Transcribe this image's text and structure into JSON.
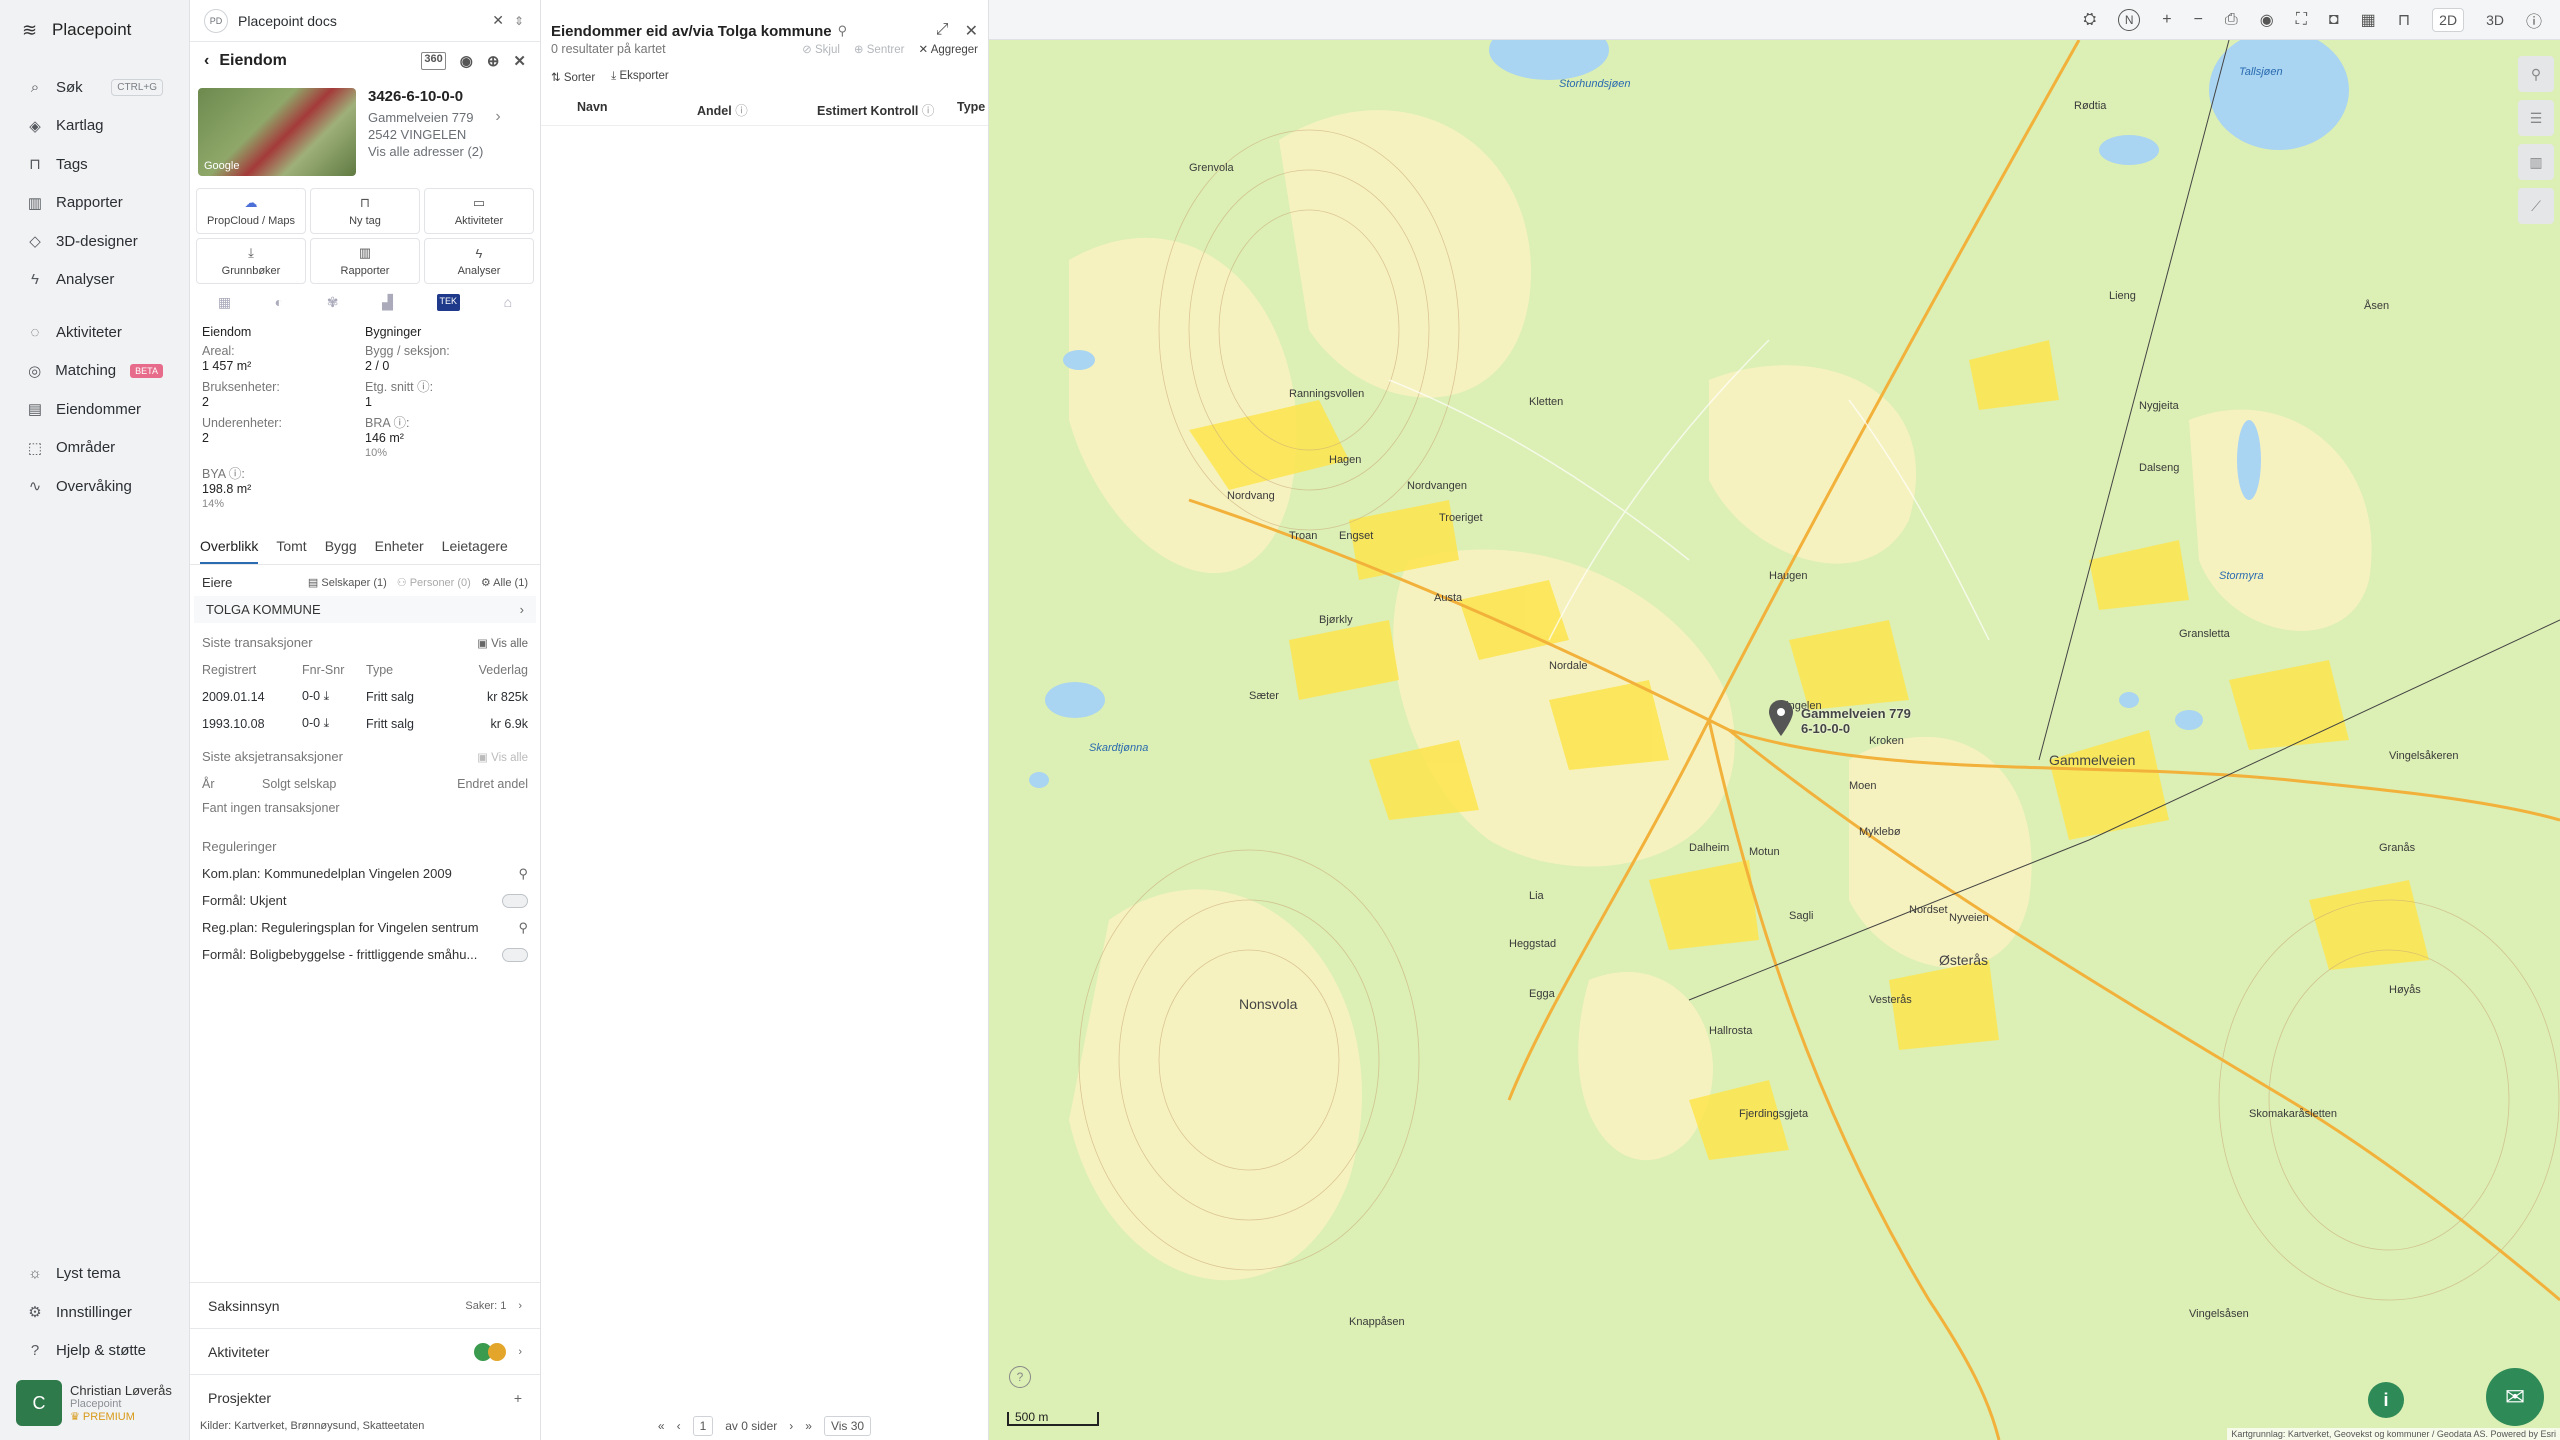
{
  "sidebar": {
    "brand": "Placepoint",
    "items": [
      {
        "label": "Søk",
        "kbd": "CTRL+G"
      },
      {
        "label": "Kartlag"
      },
      {
        "label": "Tags"
      },
      {
        "label": "Rapporter"
      },
      {
        "label": "3D-designer"
      },
      {
        "label": "Analyser"
      },
      {
        "label": "Aktiviteter"
      },
      {
        "label": "Matching",
        "badge": "BETA"
      },
      {
        "label": "Eiendommer"
      },
      {
        "label": "Områder"
      },
      {
        "label": "Overvåking"
      }
    ],
    "bottom": [
      {
        "label": "Lyst tema"
      },
      {
        "label": "Innstillinger"
      },
      {
        "label": "Hjelp & støtte"
      }
    ],
    "user": {
      "initial": "C",
      "name": "Christian Løverås",
      "org": "Placepoint",
      "plan": "PREMIUM"
    }
  },
  "panel": {
    "workspace": "Placepoint docs",
    "workspace_initials": "PD",
    "title": "Eiendom",
    "property": {
      "id": "3426-6-10-0-0",
      "address": "Gammelveien 779",
      "postal": "2542 VINGELEN",
      "all_addresses": "Vis alle adresser (2)",
      "photo_credit": "Google"
    },
    "quick": [
      {
        "label": "PropCloud / Maps"
      },
      {
        "label": "Ny tag"
      },
      {
        "label": "Aktiviteter"
      },
      {
        "label": "Grunnbøker"
      },
      {
        "label": "Rapporter"
      },
      {
        "label": "Analyser"
      }
    ],
    "tek_badge": "TEK",
    "facts": {
      "eiendom_h": "Eiendom",
      "bygninger_h": "Bygninger",
      "areal_k": "Areal:",
      "areal_v": "1 457 m²",
      "bygg_k": "Bygg / seksjon:",
      "bygg_v": "2 / 0",
      "bruks_k": "Bruksenheter:",
      "bruks_v": "2",
      "etg_k": "Etg. snitt ⓘ:",
      "etg_v": "1",
      "under_k": "Underenheter:",
      "under_v": "2",
      "bra_k": "BRA ⓘ:",
      "bra_v": "146 m²",
      "bra_pct": "10%",
      "bya_k": "BYA ⓘ:",
      "bya_v": "198.8 m²",
      "bya_pct": "14%"
    },
    "tabs": [
      "Overblikk",
      "Tomt",
      "Bygg",
      "Enheter",
      "Leietagere"
    ],
    "owners": {
      "label": "Eiere",
      "companies": "Selskaper (1)",
      "persons": "Personer (0)",
      "all": "Alle (1)",
      "owner": "TOLGA KOMMUNE"
    },
    "transactions": {
      "label": "Siste transaksjoner",
      "show_all": "Vis alle",
      "headers": [
        "Registrert",
        "Fnr-Snr",
        "Type",
        "Vederlag"
      ],
      "rows": [
        {
          "date": "2009.01.14",
          "fnr": "0-0",
          "type": "Fritt salg",
          "amount": "kr 825k"
        },
        {
          "date": "1993.10.08",
          "fnr": "0-0",
          "type": "Fritt salg",
          "amount": "kr 6.9k"
        }
      ]
    },
    "share_tx": {
      "label": "Siste aksjetransaksjoner",
      "show_all": "Vis alle",
      "headers": [
        "År",
        "Solgt selskap",
        "Endret andel"
      ],
      "empty": "Fant ingen transaksjoner"
    },
    "regulations": {
      "label": "Reguleringer",
      "rows": [
        {
          "text": "Kom.plan: Kommunedelplan Vingelen 2009"
        },
        {
          "text": "Formål: Ukjent"
        },
        {
          "text": "Reg.plan: Reguleringsplan for Vingelen sentrum"
        },
        {
          "text": "Formål: Boligbebyggelse - frittliggende småhu..."
        }
      ]
    },
    "saksinnsyn": {
      "label": "Saksinnsyn",
      "count": "Saker: 1"
    },
    "aktiviteter": {
      "label": "Aktiviteter"
    },
    "prosjekter": {
      "label": "Prosjekter"
    },
    "sources": "Kilder: Kartverket, Brønnøysund, Skatteetaten"
  },
  "middle": {
    "title": "Eiendommer eid av/via Tolga kommune",
    "results": "0 resultater på kartet",
    "actions": {
      "hide": "Skjul",
      "center": "Sentrer",
      "aggregate": "Aggreger"
    },
    "sort": "Sorter",
    "export": "Eksporter",
    "columns": [
      "Navn",
      "Andel",
      "Estimert Kontroll",
      "Type"
    ],
    "pager": {
      "page": "1",
      "of": "av 0 sider",
      "show": "Vis 30"
    }
  },
  "map": {
    "modes": [
      "2D",
      "3D"
    ],
    "compass": "N",
    "pin_label": "Gammelveien 779",
    "pin_sub": "6-10-0-0",
    "scale": "500 m",
    "attribution": "Kartgrunnlag: Kartverket, Geovekst og kommuner / Geodata AS. Powered by Esri",
    "places": [
      {
        "name": "Grenvola"
      },
      {
        "name": "Ranningsvollen"
      },
      {
        "name": "Kletten"
      },
      {
        "name": "Hagen"
      },
      {
        "name": "Nordvangen"
      },
      {
        "name": "Nordvang"
      },
      {
        "name": "Engset"
      },
      {
        "name": "Troan"
      },
      {
        "name": "Troeriget"
      },
      {
        "name": "Austa"
      },
      {
        "name": "Bjørkly"
      },
      {
        "name": "Nordale"
      },
      {
        "name": "Haugen"
      },
      {
        "name": "Vingelen"
      },
      {
        "name": "Kroken"
      },
      {
        "name": "Moen"
      },
      {
        "name": "Myklebø"
      },
      {
        "name": "Motun"
      },
      {
        "name": "Dalheim"
      },
      {
        "name": "Lia"
      },
      {
        "name": "Heggstad"
      },
      {
        "name": "Egga"
      },
      {
        "name": "Nonsvola"
      },
      {
        "name": "Sagli"
      },
      {
        "name": "Nordset"
      },
      {
        "name": "Nyveien"
      },
      {
        "name": "Østerås"
      },
      {
        "name": "Vesterås"
      },
      {
        "name": "Hallrosta"
      },
      {
        "name": "Fjerdingsgjeta"
      },
      {
        "name": "Knappåsen"
      },
      {
        "name": "Gammelveien"
      },
      {
        "name": "Skomakaråsletten"
      },
      {
        "name": "Vingelsåsen"
      },
      {
        "name": "Stormyra"
      },
      {
        "name": "Storhundsjøen"
      },
      {
        "name": "Tallsjøen"
      },
      {
        "name": "Rødtia"
      },
      {
        "name": "Åsen"
      },
      {
        "name": "Lieng"
      },
      {
        "name": "Nygjeita"
      },
      {
        "name": "Dalseng"
      },
      {
        "name": "Gransletta"
      },
      {
        "name": "Vingelsåkeren"
      },
      {
        "name": "Granås"
      },
      {
        "name": "Høyås"
      },
      {
        "name": "Skardtjønna"
      },
      {
        "name": "Sæter"
      }
    ]
  }
}
